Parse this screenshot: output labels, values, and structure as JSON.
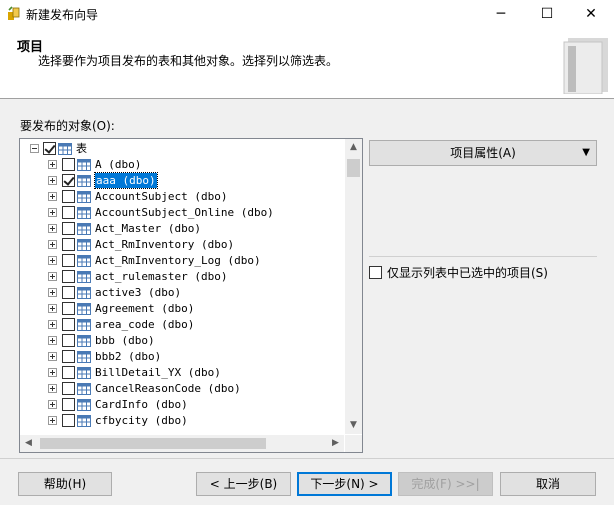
{
  "window": {
    "title": "新建发布向导",
    "minimize": "─",
    "maximize": "☐",
    "close": "✕"
  },
  "header": {
    "title": "项目",
    "description": "选择要作为项目发布的表和其他对象。选择列以筛选表。"
  },
  "objects_label": "要发布的对象(O):",
  "tree": {
    "root_label": "表",
    "items": [
      {
        "name": "A (dbo)",
        "checked": false,
        "selected": false
      },
      {
        "name": "aaa (dbo)",
        "checked": true,
        "selected": true
      },
      {
        "name": "AccountSubject (dbo)",
        "checked": false,
        "selected": false
      },
      {
        "name": "AccountSubject_Online (dbo)",
        "checked": false,
        "selected": false
      },
      {
        "name": "Act_Master (dbo)",
        "checked": false,
        "selected": false
      },
      {
        "name": "Act_RmInventory (dbo)",
        "checked": false,
        "selected": false
      },
      {
        "name": "Act_RmInventory_Log (dbo)",
        "checked": false,
        "selected": false
      },
      {
        "name": "act_rulemaster (dbo)",
        "checked": false,
        "selected": false
      },
      {
        "name": "active3 (dbo)",
        "checked": false,
        "selected": false
      },
      {
        "name": "Agreement (dbo)",
        "checked": false,
        "selected": false
      },
      {
        "name": "area_code (dbo)",
        "checked": false,
        "selected": false
      },
      {
        "name": "bbb (dbo)",
        "checked": false,
        "selected": false
      },
      {
        "name": "bbb2 (dbo)",
        "checked": false,
        "selected": false
      },
      {
        "name": "BillDetail_YX (dbo)",
        "checked": false,
        "selected": false
      },
      {
        "name": "CancelReasonCode (dbo)",
        "checked": false,
        "selected": false
      },
      {
        "name": "CardInfo (dbo)",
        "checked": false,
        "selected": false
      },
      {
        "name": "cfbycity (dbo)",
        "checked": false,
        "selected": false
      }
    ]
  },
  "properties_button": "项目属性(A)",
  "only_selected_label": "仅显示列表中已选中的项目(S)",
  "buttons": {
    "help": "帮助(H)",
    "back": "< 上一步(B)",
    "next": "下一步(N) >",
    "finish": "完成(F) >>|",
    "cancel": "取消"
  }
}
